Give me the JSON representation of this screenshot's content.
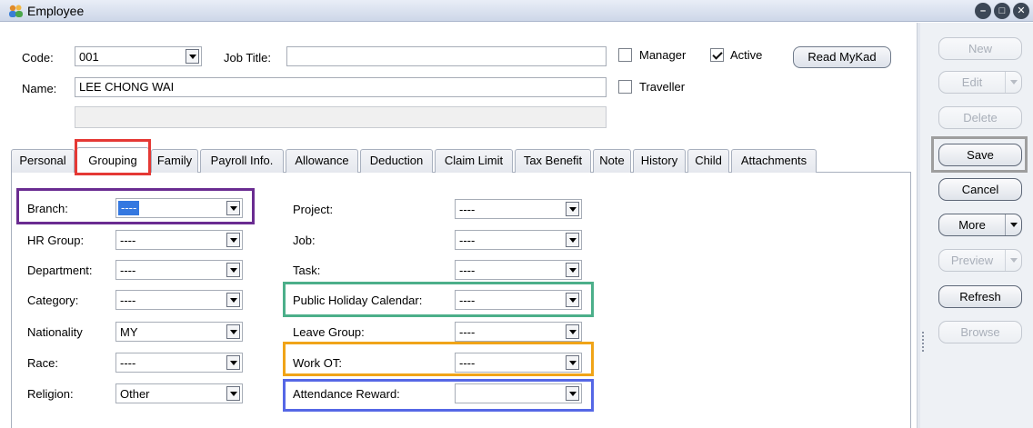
{
  "window": {
    "title": "Employee",
    "controls": [
      "–",
      "□",
      "✕"
    ]
  },
  "header": {
    "code_label": "Code:",
    "code_value": "001",
    "job_title_label": "Job Title:",
    "job_title_value": "",
    "name_label": "Name:",
    "name_value": "LEE CHONG WAI",
    "name2_value": "",
    "manager_label": "Manager",
    "manager_checked": false,
    "active_label": "Active",
    "active_checked": true,
    "traveller_label": "Traveller",
    "traveller_checked": false,
    "read_mykad_label": "Read MyKad"
  },
  "tabs": [
    {
      "label": "Personal",
      "active": false
    },
    {
      "label": "Grouping",
      "active": true
    },
    {
      "label": "Family",
      "active": false
    },
    {
      "label": "Payroll Info.",
      "active": false
    },
    {
      "label": "Allowance",
      "active": false
    },
    {
      "label": "Deduction",
      "active": false
    },
    {
      "label": "Claim Limit",
      "active": false
    },
    {
      "label": "Tax Benefit",
      "active": false
    },
    {
      "label": "Note",
      "active": false
    },
    {
      "label": "History",
      "active": false
    },
    {
      "label": "Child",
      "active": false
    },
    {
      "label": "Attachments",
      "active": false
    }
  ],
  "grouping": {
    "left": [
      {
        "label": "Branch:",
        "value": "----"
      },
      {
        "label": "HR Group:",
        "value": "----"
      },
      {
        "label": "Department:",
        "value": "----"
      },
      {
        "label": "Category:",
        "value": "----"
      },
      {
        "label": "Nationality",
        "value": "MY"
      },
      {
        "label": "Race:",
        "value": "----"
      },
      {
        "label": "Religion:",
        "value": "Other"
      }
    ],
    "right": [
      {
        "label": "Project:",
        "value": "----"
      },
      {
        "label": "Job:",
        "value": "----"
      },
      {
        "label": "Task:",
        "value": "----"
      },
      {
        "label": "Public Holiday Calendar:",
        "value": "----"
      },
      {
        "label": "Leave Group:",
        "value": "----"
      },
      {
        "label": "Work OT:",
        "value": "----"
      },
      {
        "label": "Attendance Reward:",
        "value": ""
      }
    ]
  },
  "highlight_colors": {
    "grouping_tab": "#e53935",
    "branch": "#6a2c91",
    "public_holiday": "#4caf8a",
    "work_ot": "#f0a418",
    "attendance_reward": "#5567e6",
    "save": "#9e9e9e"
  },
  "side_buttons": {
    "new": "New",
    "edit": "Edit",
    "delete": "Delete",
    "save": "Save",
    "cancel": "Cancel",
    "more": "More",
    "preview": "Preview",
    "refresh": "Refresh",
    "browse": "Browse"
  }
}
